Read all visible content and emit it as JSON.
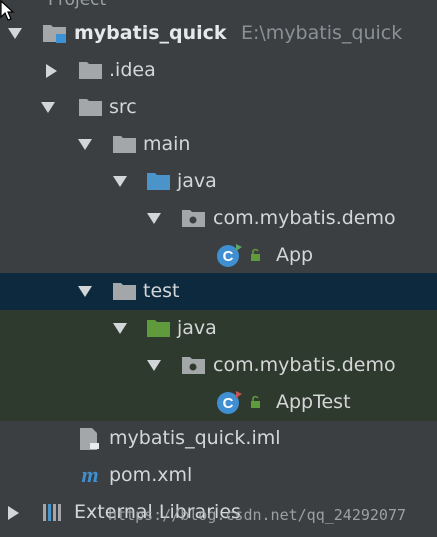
{
  "header": {
    "panel_title": "Project"
  },
  "tree": {
    "root": {
      "label": "mybatis_quick",
      "path": "E:\\mybatis_quick"
    },
    "idea": {
      "label": ".idea"
    },
    "src": {
      "label": "src"
    },
    "main": {
      "label": "main"
    },
    "main_java": {
      "label": "java"
    },
    "main_pkg": {
      "label": "com.mybatis.demo"
    },
    "main_class": {
      "label": "App"
    },
    "test": {
      "label": "test"
    },
    "test_java": {
      "label": "java"
    },
    "test_pkg": {
      "label": "com.mybatis.demo"
    },
    "test_class": {
      "label": "AppTest"
    },
    "iml": {
      "label": "mybatis_quick.iml"
    },
    "pom": {
      "label": "pom.xml"
    },
    "ext": {
      "label": "External Libraries"
    }
  },
  "watermark": {
    "text": "https://blog.csdn.net/qq_24292077"
  },
  "icons": {
    "folder": "folder-icon",
    "module": "module-icon",
    "source_root": "source-root-icon",
    "test_root": "test-root-icon",
    "package": "package-icon",
    "class": "java-class-icon",
    "iml": "iml-file-icon",
    "maven": "maven-icon",
    "libraries": "libraries-icon"
  },
  "colors": {
    "background": "#3c3f41",
    "selection": "#0d293e",
    "test_zone": "#2f3a2f",
    "folder": "#a3a7aa",
    "source_folder": "#4a94c9",
    "test_folder": "#5f9b3c",
    "class_badge": "#3f8fd2"
  }
}
